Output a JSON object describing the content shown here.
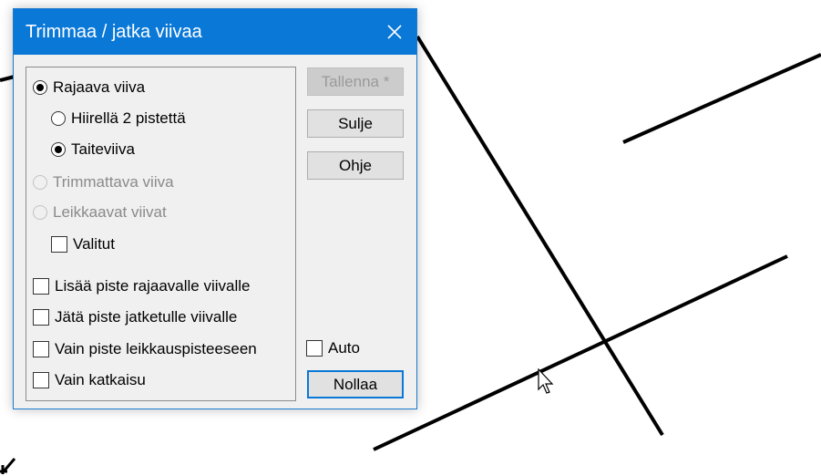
{
  "dialog": {
    "title": "Trimmaa / jatka viivaa",
    "options": {
      "rajaava": {
        "label": "Rajaava viiva",
        "checked": true,
        "enabled": true
      },
      "hiirella": {
        "label": "Hiirellä 2 pistettä",
        "checked": false,
        "enabled": true
      },
      "taiteviiva": {
        "label": "Taiteviiva",
        "checked": true,
        "enabled": true
      },
      "trimmattava": {
        "label": "Trimmattava viiva",
        "checked": false,
        "enabled": false
      },
      "leikkaavat": {
        "label": "Leikkaavat viivat",
        "checked": false,
        "enabled": false
      },
      "valitut": {
        "label": "Valitut",
        "checked": false
      },
      "lisaa_piste": {
        "label": "Lisää piste rajaavalle viivalle",
        "checked": false
      },
      "jata_piste": {
        "label": "Jätä piste jatketulle viivalle",
        "checked": false
      },
      "vain_piste": {
        "label": "Vain piste leikkauspisteeseen",
        "checked": false
      },
      "vain_katkaisu": {
        "label": "Vain katkaisu",
        "checked": false
      },
      "auto": {
        "label": "Auto",
        "checked": false
      }
    },
    "buttons": {
      "tallenna": "Tallenna *",
      "sulje": "Sulje",
      "ohje": "Ohje",
      "nollaa": "Nollaa"
    }
  },
  "colors": {
    "titlebar": "#0a78d7",
    "dialog_bg": "#f0f0f0",
    "line": "#000000"
  },
  "icons": {
    "close": "close-icon",
    "cursor": "mouse-pointer-icon",
    "arrow": "arrow-icon"
  }
}
